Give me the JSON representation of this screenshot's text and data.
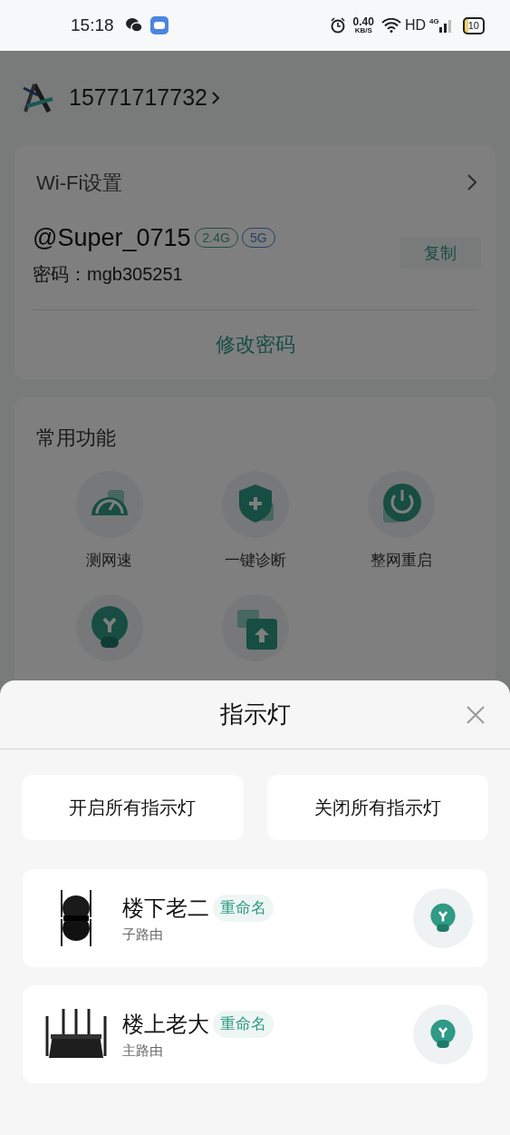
{
  "status_bar": {
    "time": "15:18",
    "net_speed": "0.40",
    "net_speed_unit": "KB/S",
    "hd": "HD",
    "network": "4G",
    "battery": "10"
  },
  "account": {
    "phone": "15771717732"
  },
  "wifi_card": {
    "title": "Wi-Fi设置",
    "ssid": "@Super_0715",
    "bands": [
      {
        "label": "2.4G",
        "color": "#1f5240"
      },
      {
        "label": "5G",
        "color": "#24406a"
      }
    ],
    "password": "密码：mgb305251",
    "copy_button": "复制",
    "change_password": "修改密码"
  },
  "functions": {
    "title": "常用功能",
    "items": [
      {
        "kind": "speed",
        "label": "测网速"
      },
      {
        "kind": "shield",
        "label": "一键诊断"
      },
      {
        "kind": "power",
        "label": "整网重启"
      },
      {
        "kind": "bulb"
      },
      {
        "kind": "upload"
      }
    ]
  },
  "sheet": {
    "title": "指示灯",
    "actions": [
      "开启所有指示灯",
      "关闭所有指示灯"
    ],
    "devices": [
      {
        "kind": "satellite",
        "name": "楼下老二",
        "rename": "重命名",
        "role": "子路由"
      },
      {
        "kind": "main",
        "name": "楼上老大",
        "rename": "重命名",
        "role": "主路由"
      }
    ]
  }
}
